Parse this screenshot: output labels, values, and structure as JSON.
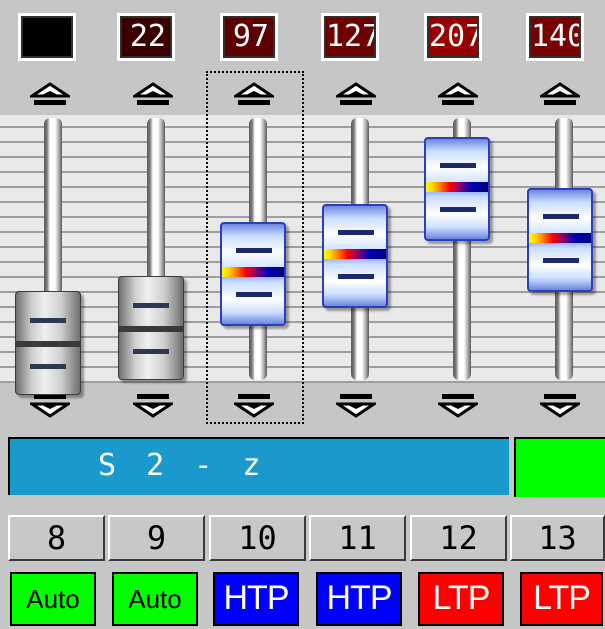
{
  "channels": [
    {
      "value": "",
      "value_bg": "#000000",
      "number": "8",
      "mode": "Auto",
      "mode_bg": "#00ff00",
      "mode_fg": "#000000",
      "fader_style": "gray"
    },
    {
      "value": "22",
      "value_bg": "#3a0000",
      "number": "9",
      "mode": "Auto",
      "mode_bg": "#00ff00",
      "mode_fg": "#000000",
      "fader_style": "gray"
    },
    {
      "value": "97",
      "value_bg": "#5e0000",
      "number": "10",
      "mode": "HTP",
      "mode_bg": "#0000ff",
      "mode_fg": "#ffffff",
      "fader_style": "blue"
    },
    {
      "value": "127",
      "value_bg": "#6e0000",
      "number": "11",
      "mode": "HTP",
      "mode_bg": "#0000ff",
      "mode_fg": "#ffffff",
      "fader_style": "blue"
    },
    {
      "value": "207",
      "value_bg": "#960000",
      "number": "12",
      "mode": "LTP",
      "mode_bg": "#ff0000",
      "mode_fg": "#ffffff",
      "fader_style": "blue"
    },
    {
      "value": "140",
      "value_bg": "#780000",
      "number": "13",
      "mode": "LTP",
      "mode_bg": "#ff0000",
      "mode_fg": "#ffffff",
      "fader_style": "blue"
    }
  ],
  "selected_channel": "10",
  "name_bar": {
    "text": "S 2 - z",
    "bg": "#1a99cc"
  },
  "status_color": "#00ff00",
  "icons": {
    "up": "fader-up-arrow-icon",
    "down": "fader-down-arrow-icon"
  }
}
